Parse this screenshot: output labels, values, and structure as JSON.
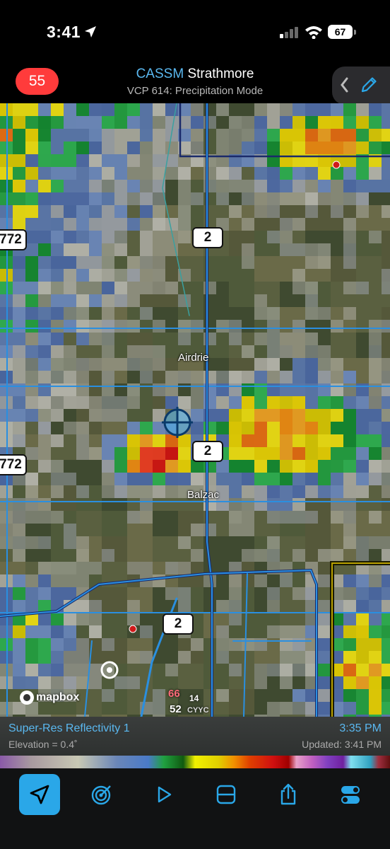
{
  "status": {
    "time": "3:41",
    "battery": "67"
  },
  "header": {
    "alert_count": "55",
    "site_code": "CASSM",
    "site_name": "Strathmore",
    "mode": "VCP 614: Precipitation Mode"
  },
  "map": {
    "shields": [
      "2",
      "772",
      "2",
      "772",
      "2"
    ],
    "towns": [
      "Airdrie",
      "Balzac"
    ],
    "attribution": "mapbox",
    "station": {
      "temperature": "66",
      "dewpoint": "52",
      "id": "CYYC",
      "wind": "14"
    }
  },
  "info": {
    "product": "Super-Res Reflectivity 1",
    "elevation": "Elevation = 0.4˚",
    "scan_time": "3:35 PM",
    "updated": "Updated: 3:41 PM"
  },
  "colors": {
    "accent": "#2aa7e8",
    "badge": "#ff3b3b",
    "site_code": "#5ab8f0"
  },
  "toolbar": {
    "icons": [
      "location-arrow-icon",
      "radar-target-icon",
      "play-icon",
      "split-view-icon",
      "share-icon",
      "toggles-icon"
    ]
  }
}
